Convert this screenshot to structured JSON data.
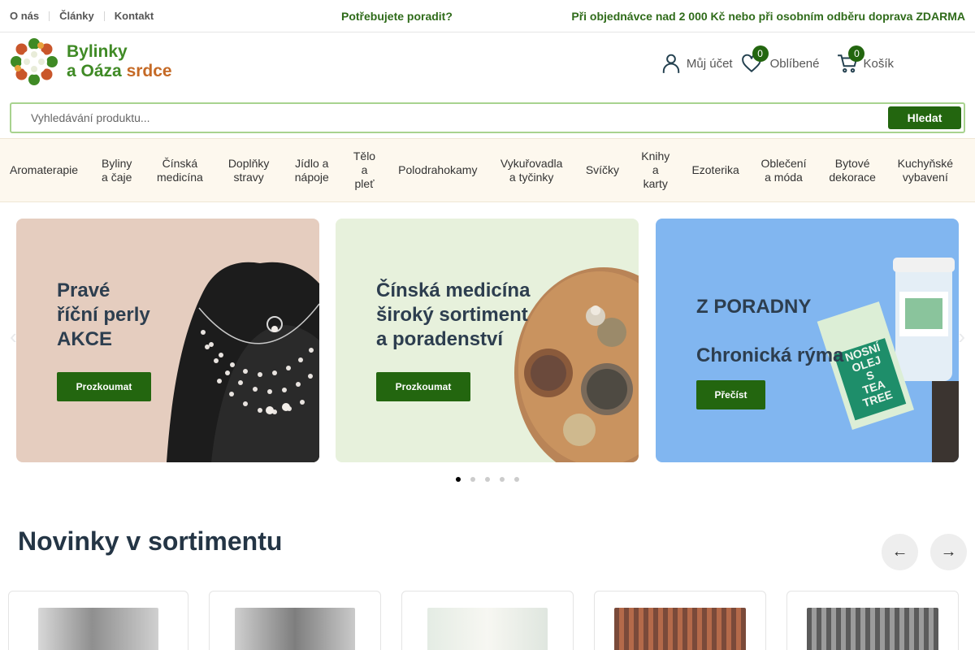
{
  "topbar": {
    "links": [
      "O nás",
      "Články",
      "Kontakt"
    ],
    "advice": "Potřebujete poradit?",
    "shipping": "Při objednávce nad 2 000 Kč nebo při osobním odběru doprava ZDARMA"
  },
  "logo": {
    "line1": "Bylinky",
    "line2_a": "a Oáza",
    "line2_b": "srdce"
  },
  "header": {
    "account_label": "Můj účet",
    "favorites_label": "Oblíbené",
    "favorites_count": "0",
    "cart_label": "Košík",
    "cart_count": "0"
  },
  "search": {
    "placeholder": "Vyhledávání produktu...",
    "button": "Hledat"
  },
  "nav": {
    "items": [
      "Aromaterapie",
      "Byliny a čaje",
      "Čínská medicína",
      "Doplňky stravy",
      "Jídlo a nápoje",
      "Tělo a pleť",
      "Polodrahokamy",
      "Vykuřovadla a tyčinky",
      "Svíčky",
      "Knihy a karty",
      "Ezoterika",
      "Oblečení a móda",
      "Bytové dekorace",
      "Kuchyňské vybavení"
    ]
  },
  "slider": {
    "slides": [
      {
        "title_lines": [
          "Pravé",
          "říční perly",
          "AKCE"
        ],
        "button": "Prozkoumat"
      },
      {
        "title_lines": [
          "Čínská medicína",
          "široký sortiment",
          "a poradenství"
        ],
        "button": "Prozkoumat"
      },
      {
        "title_lines": [
          "Z PORADNY",
          "",
          "Chronická rýma"
        ],
        "button": "Přečíst",
        "product_label": [
          "NOSNÍ",
          "OLEJ",
          "S",
          "TEA TREE"
        ]
      }
    ],
    "dots": 5,
    "active_dot": 1
  },
  "section": {
    "title": "Novinky v sortimentu"
  },
  "colors": {
    "brand_green": "#23660f",
    "text_green": "#2f6b1a",
    "nav_bg": "#fdf8ee"
  }
}
